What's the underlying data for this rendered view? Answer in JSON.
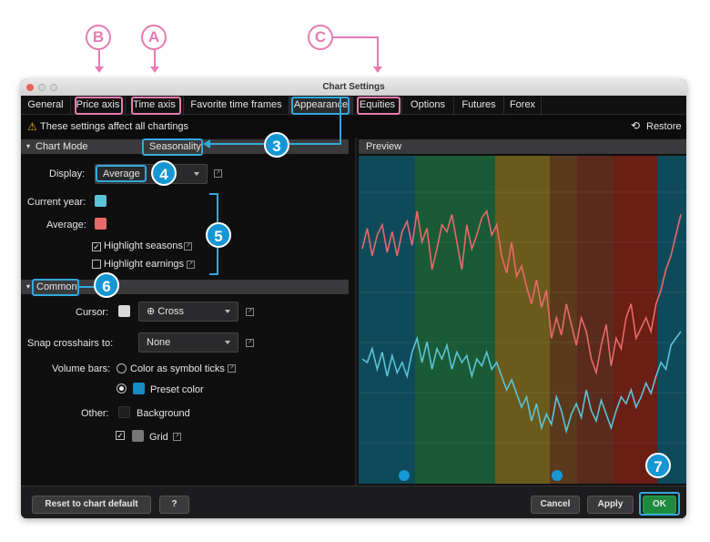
{
  "callouts": {
    "letters": {
      "b": "B",
      "a": "A",
      "c": "C"
    },
    "numbers": {
      "n3": "3",
      "n4": "4",
      "n5": "5",
      "n6": "6",
      "n7": "7"
    }
  },
  "window": {
    "title": "Chart Settings",
    "tabs": [
      {
        "label": "General"
      },
      {
        "label": "Price axis"
      },
      {
        "label": "Time axis"
      },
      {
        "label": "Favorite time frames"
      },
      {
        "label": "Appearance"
      },
      {
        "label": "Equities"
      },
      {
        "label": "Options"
      },
      {
        "label": "Futures"
      },
      {
        "label": "Forex"
      }
    ],
    "active_tab": "Appearance",
    "warning_text": "These settings affect all chartings",
    "restore_label": "Restore"
  },
  "chart_mode": {
    "header": "Chart Mode",
    "mode_value": "Seasonality",
    "display_label": "Display:",
    "display_value": "Average",
    "current_year_label": "Current year:",
    "average_label": "Average:",
    "highlight_seasons": {
      "label": "Highlight seasons",
      "checked": true
    },
    "highlight_earnings": {
      "label": "Highlight earnings",
      "checked": false
    },
    "current_year_color": "#5bc3d6",
    "average_color": "#e8696a"
  },
  "common": {
    "header": "Common",
    "cursor_label": "Cursor:",
    "cursor_value": "Cross",
    "snap_label": "Snap crosshairs to:",
    "snap_value": "None",
    "volume_label": "Volume bars:",
    "volume_opt1": "Color as symbol ticks",
    "volume_opt2": "Preset color",
    "volume_selected": "Preset color",
    "other_label": "Other:",
    "background_label": "Background",
    "grid_label": "Grid",
    "grid_checked": true,
    "preset_color": "#1a8ac2",
    "cursor_swatch": "#d9d9d9",
    "background_swatch": "#1e1e1e",
    "grid_swatch": "#777777"
  },
  "preview": {
    "header": "Preview",
    "season_bands": [
      {
        "color": "#0f4a5a"
      },
      {
        "color": "#1a5a36"
      },
      {
        "color": "#1a5a36"
      },
      {
        "color": "#6a5a1c"
      },
      {
        "color": "#5a3a1c"
      },
      {
        "color": "#5a2a1c"
      },
      {
        "color": "#6a1e14"
      },
      {
        "color": "#0f4a5a"
      }
    ]
  },
  "chart_data": {
    "type": "line",
    "series": [
      {
        "color": "#e8696a",
        "values": [
          64,
          70,
          62,
          68,
          71,
          63,
          69,
          62,
          69,
          72,
          65,
          75,
          66,
          70,
          58,
          64,
          71,
          69,
          74,
          66,
          58,
          71,
          64,
          68,
          73,
          75,
          68,
          71,
          62,
          57,
          66,
          56,
          59,
          53,
          48,
          55,
          47,
          52,
          38,
          44,
          39,
          48,
          42,
          36,
          44,
          40,
          32,
          28,
          36,
          42,
          30,
          38,
          35,
          44,
          48,
          38,
          41,
          44,
          40,
          48,
          52,
          58,
          62,
          68,
          74
        ]
      },
      {
        "color": "#5bc3d6",
        "values": [
          32,
          31,
          35,
          29,
          34,
          27,
          33,
          28,
          31,
          27,
          34,
          38,
          31,
          37,
          29,
          35,
          32,
          36,
          29,
          34,
          31,
          33,
          27,
          32,
          30,
          34,
          29,
          31,
          27,
          23,
          26,
          22,
          18,
          21,
          14,
          19,
          12,
          16,
          13,
          21,
          17,
          11,
          16,
          19,
          15,
          23,
          17,
          14,
          20,
          16,
          12,
          17,
          21,
          19,
          23,
          18,
          21,
          25,
          22,
          27,
          31,
          29,
          36,
          38,
          40
        ]
      }
    ],
    "ylim": [
      0,
      90
    ]
  },
  "footer": {
    "reset_label": "Reset to chart default",
    "help_icon": "?",
    "cancel_label": "Cancel",
    "apply_label": "Apply",
    "ok_label": "OK"
  },
  "colors": {
    "pink": "#e77bb3",
    "blue": "#33a8dc",
    "badge": "#1697d4",
    "ok_green": "#1f8a3e"
  }
}
